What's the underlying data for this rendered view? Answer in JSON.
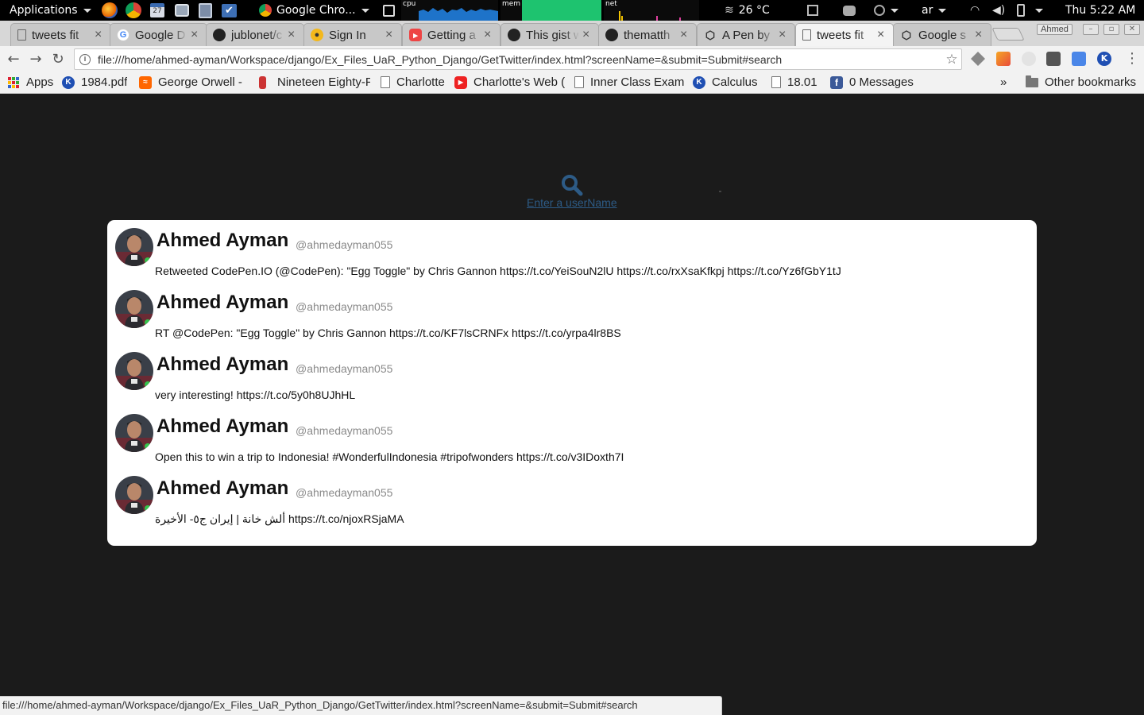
{
  "panel": {
    "applications_label": "Applications",
    "window_button_label": "Google Chro...",
    "cpu_label": "cpu",
    "mem_label": "mem",
    "net_label": "net",
    "weather": "26 °C",
    "keyboard_layout": "ar",
    "clock": "Thu  5:22 AM",
    "launchers": [
      "firefox-icon",
      "chrome-icon",
      "calendar-icon",
      "screenshot-icon",
      "disk-icon",
      "todo-icon"
    ]
  },
  "tabs": [
    {
      "title": "tweets fit",
      "favicon": "page-icon"
    },
    {
      "title": "Google D",
      "favicon": "google-icon"
    },
    {
      "title": "jublonet/c",
      "favicon": "github-icon"
    },
    {
      "title": "Sign In",
      "favicon": "signin-icon"
    },
    {
      "title": "Getting a",
      "favicon": "youtube-icon"
    },
    {
      "title": "This gist w",
      "favicon": "github-icon"
    },
    {
      "title": "thematth",
      "favicon": "github-icon"
    },
    {
      "title": "A Pen by",
      "favicon": "codepen-icon"
    },
    {
      "title": "tweets fit",
      "favicon": "page-icon",
      "active": true
    },
    {
      "title": "Google s",
      "favicon": "codepen-icon"
    }
  ],
  "window": {
    "profile_name": "Ahmed"
  },
  "toolbar": {
    "url": "file:///home/ahmed-ayman/Workspace/django/Ex_Files_UaR_Python_Django/GetTwitter/index.html?screenName=&submit=Submit#search"
  },
  "bookmarks": {
    "items": [
      {
        "label": "Apps",
        "icon": "apps-grid-icon"
      },
      {
        "label": "1984.pdf",
        "icon": "k-icon"
      },
      {
        "label": "George Orwell -",
        "icon": "soundcloud-icon"
      },
      {
        "label": "Nineteen Eighty-F",
        "icon": "bookmark-page-icon"
      },
      {
        "label": "Charlotte",
        "icon": "document-icon"
      },
      {
        "label": "Charlotte's Web (",
        "icon": "youtube-icon"
      },
      {
        "label": "Inner Class Examp",
        "icon": "document-icon"
      },
      {
        "label": "Calculus",
        "icon": "k-icon"
      },
      {
        "label": "18.01",
        "icon": "document-icon"
      },
      {
        "label": "0 Messages",
        "icon": "facebook-icon"
      }
    ],
    "overflow": "»",
    "other_label": "Other bookmarks"
  },
  "search": {
    "link_text": "Enter a userName"
  },
  "tweets": [
    {
      "name": "Ahmed Ayman",
      "handle": "@ahmedayman055",
      "text": "Retweeted CodePen.IO (@CodePen): \"Egg Toggle\" by Chris Gannon https://t.co/YeiSouN2lU https://t.co/rxXsaKfkpj https://t.co/Yz6fGbY1tJ"
    },
    {
      "name": "Ahmed Ayman",
      "handle": "@ahmedayman055",
      "text": "RT @CodePen: \"Egg Toggle\" by Chris Gannon https://t.co/KF7lsCRNFx https://t.co/yrpa4lr8BS"
    },
    {
      "name": "Ahmed Ayman",
      "handle": "@ahmedayman055",
      "text": "very interesting! https://t.co/5y0h8UJhHL"
    },
    {
      "name": "Ahmed Ayman",
      "handle": "@ahmedayman055",
      "text": "Open this to win a trip to Indonesia! #WonderfulIndonesia #tripofwonders https://t.co/v3IDoxth7I"
    },
    {
      "name": "Ahmed Ayman",
      "handle": "@ahmedayman055",
      "text": "ألش خانة | إيران ج٥- الأخيرة https://t.co/njoxRSjaMA"
    }
  ],
  "status": {
    "text": "file:///home/ahmed-ayman/Workspace/django/Ex_Files_UaR_Python_Django/GetTwitter/index.html?screenName=&submit=Submit#search"
  },
  "colors": {
    "page_background": "#1b1b1b",
    "card_background": "#ffffff",
    "search_icon": "#2d5b86",
    "handle_gray": "#8a8a8a"
  }
}
